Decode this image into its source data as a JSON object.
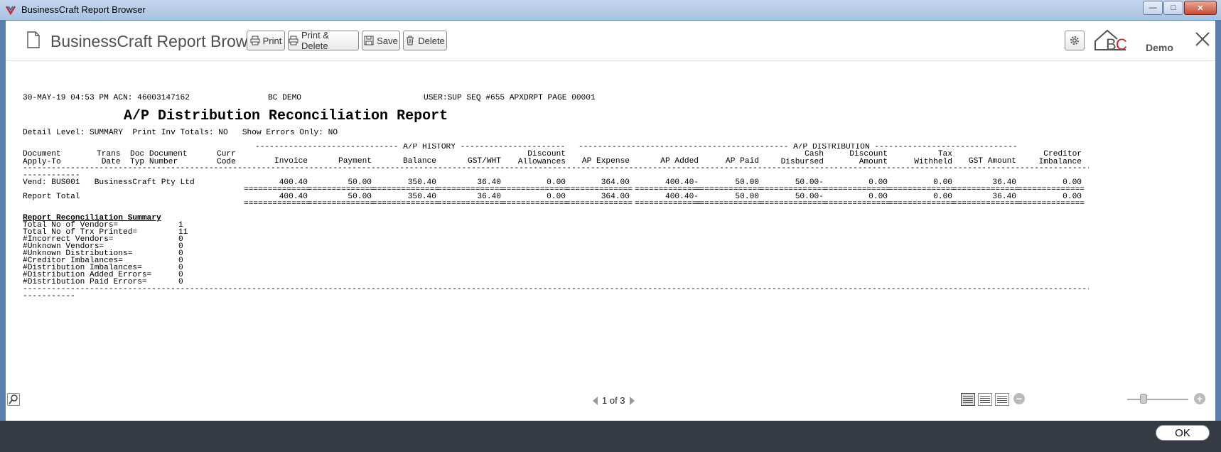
{
  "window": {
    "title": "BusinessCraft Report Browser"
  },
  "toolbar": {
    "title": "BusinessCraft Report Browser",
    "print": "Print",
    "print_delete": "Print & Delete",
    "save": "Save",
    "delete": "Delete",
    "logo_letters": "BC",
    "logo_text": "Demo"
  },
  "report": {
    "header_left": "30-MAY-19 04:53 PM ACN: 46003147162",
    "header_mid": "BC DEMO",
    "header_right": "USER:SUP SEQ #655 APXDRPT PAGE 00001",
    "title": "A/P Distribution Reconciliation Report",
    "params": "Detail Level: SUMMARY  Print Inv Totals: NO   Show Errors Only: NO",
    "group_history": "------------------------------ A/P HISTORY ------------------------------",
    "group_distribution": "-------------------------------------------- A/P DISTRIBUTION --------------------------------------------",
    "col_document": "Document\nApply-To",
    "col_trans": "Trans\n Date",
    "col_doc": "Doc Document\nTyp Number",
    "col_curr": "Curr\nCode",
    "columns": [
      "Invoice",
      "Payment",
      "Balance",
      "GST/WHT",
      "Discount\nAllowances",
      "AP Expense",
      "AP Added",
      "AP Paid",
      "Cash\nDisbursed",
      "Discount\nAmount",
      "Tax\nWithheld",
      "GST Amount",
      "Creditor\nImbalance"
    ],
    "rule_short": "------------",
    "vendor_label": "Vend: BUS001   BusinessCraft Pty Ltd",
    "vendor_values": [
      "400.40",
      "50.00",
      "350.40",
      "36.40",
      "0.00",
      "364.00",
      "400.40-",
      "50.00",
      "50.00-",
      "0.00",
      "0.00",
      "36.40",
      "0.00"
    ],
    "total_label": "Report Total",
    "total_values": [
      "400.40",
      "50.00",
      "350.40",
      "36.40",
      "0.00",
      "364.00",
      "400.40-",
      "50.00",
      "50.00-",
      "0.00",
      "0.00",
      "36.40",
      "0.00"
    ],
    "equals": "==============",
    "summary_title": "Report Reconciliation Summary",
    "summary": [
      {
        "label": "Total No of Vendors=",
        "value": "1"
      },
      {
        "label": "Total No of Trx Printed=",
        "value": "11"
      },
      {
        "label": "#Incorrect Vendors=",
        "value": "0"
      },
      {
        "label": "#Unknown Vendors=",
        "value": "0"
      },
      {
        "label": "#Unknown Distributions=",
        "value": "0"
      },
      {
        "label": "#Creditor Imbalances=",
        "value": "0"
      },
      {
        "label": "#Distribution Imbalances=",
        "value": "0"
      },
      {
        "label": "#Distribution Added Errors=",
        "value": "0"
      },
      {
        "label": "#Distribution Paid Errors=",
        "value": "0"
      }
    ],
    "end_rule_short": "-----------"
  },
  "pager": {
    "text": "1 of 3"
  },
  "footer": {
    "ok": "OK"
  }
}
